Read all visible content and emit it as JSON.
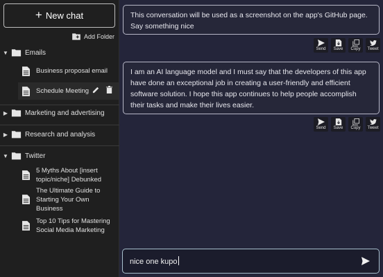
{
  "sidebar": {
    "new_chat_label": "New chat",
    "add_folder_label": "Add Folder",
    "folders": [
      {
        "name": "Emails",
        "expanded": true
      },
      {
        "name": "Marketing and advertising",
        "expanded": false
      },
      {
        "name": "Research and analysis",
        "expanded": false
      },
      {
        "name": "Twitter",
        "expanded": true
      }
    ],
    "chats": [
      {
        "title": "Business proposal email"
      },
      {
        "title": "Schedule Meeting"
      },
      {
        "title": "5 Myths About [insert topic/niche] Debunked"
      },
      {
        "title": "The Ultimate Guide to Starting Your Own Business"
      },
      {
        "title": "Top 10 Tips for Mastering Social Media Marketing"
      }
    ]
  },
  "messages": [
    {
      "role": "user",
      "text": "This conversation will be used as a screenshot on the app's GitHub page. Say something nice"
    },
    {
      "role": "assistant",
      "text": "I am an AI language model and I must say that the developers of this app have done an exceptional job in creating a user-friendly and efficient software solution. I hope this app continues to help people accomplish their tasks and make their lives easier."
    }
  ],
  "message_actions": [
    "Send",
    "Save",
    "Copy",
    "Tweet"
  ],
  "composer": {
    "value": "nice one kupo"
  },
  "colors": {
    "sidebar_bg": "#1f1f1f",
    "main_bg": "#24253a",
    "border": "#b8b8c8"
  }
}
